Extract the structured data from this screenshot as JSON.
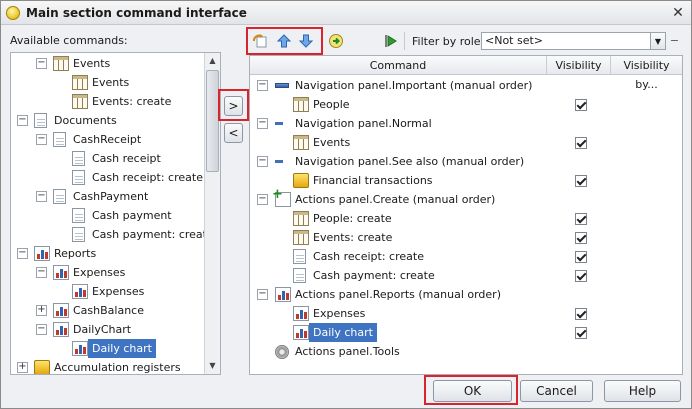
{
  "window": {
    "title": "Main section command interface",
    "close": "✕"
  },
  "left": {
    "label": "Available commands:",
    "tree": [
      {
        "level": 1,
        "toggle": "−",
        "icon": "catalog-icon",
        "label": "Events"
      },
      {
        "level": 2,
        "toggle": "",
        "icon": "catalog-icon",
        "label": "Events"
      },
      {
        "level": 2,
        "toggle": "",
        "icon": "catalog-icon",
        "label": "Events: create"
      },
      {
        "level": 0,
        "toggle": "−",
        "icon": "document-icon",
        "label": "Documents"
      },
      {
        "level": 1,
        "toggle": "−",
        "icon": "document-icon",
        "label": "CashReceipt"
      },
      {
        "level": 2,
        "toggle": "",
        "icon": "document-icon",
        "label": "Cash receipt"
      },
      {
        "level": 2,
        "toggle": "",
        "icon": "document-icon",
        "label": "Cash receipt: create"
      },
      {
        "level": 1,
        "toggle": "−",
        "icon": "document-icon",
        "label": "CashPayment"
      },
      {
        "level": 2,
        "toggle": "",
        "icon": "document-icon",
        "label": "Cash payment"
      },
      {
        "level": 2,
        "toggle": "",
        "icon": "document-icon",
        "label": "Cash payment: create"
      },
      {
        "level": 0,
        "toggle": "−",
        "icon": "report-icon",
        "label": "Reports"
      },
      {
        "level": 1,
        "toggle": "−",
        "icon": "report-icon",
        "label": "Expenses"
      },
      {
        "level": 2,
        "toggle": "",
        "icon": "report-icon",
        "label": "Expenses"
      },
      {
        "level": 1,
        "toggle": "+",
        "icon": "report-icon",
        "label": "CashBalance"
      },
      {
        "level": 1,
        "toggle": "−",
        "icon": "report-icon",
        "label": "DailyChart"
      },
      {
        "level": 2,
        "toggle": "",
        "icon": "report-icon",
        "label": "Daily chart",
        "selected": true
      },
      {
        "level": 0,
        "toggle": "+",
        "icon": "accumulation-register-icon",
        "label": "Accumulation registers"
      }
    ]
  },
  "middle": {
    "add": ">",
    "remove": "<"
  },
  "toolbar": {
    "filter_label": "Filter by roles:",
    "filter_value": "<Not set>",
    "filter_dropdown": "▼",
    "filter_clear": "−"
  },
  "right": {
    "columns": [
      "Command",
      "Visibility",
      "Visibility by..."
    ],
    "rows": [
      {
        "level": 0,
        "toggle": "−",
        "icon": "navigation-panel-icon",
        "label": "Navigation panel.Important (manual order)",
        "check": false
      },
      {
        "level": 1,
        "toggle": "",
        "icon": "catalog-icon",
        "label": "People",
        "check": true
      },
      {
        "level": 0,
        "toggle": "−",
        "icon": "navigation-small-icon",
        "label": "Navigation panel.Normal",
        "check": false
      },
      {
        "level": 1,
        "toggle": "",
        "icon": "catalog-icon",
        "label": "Events",
        "check": true
      },
      {
        "level": 0,
        "toggle": "−",
        "icon": "navigation-small-icon",
        "label": "Navigation panel.See also (manual order)",
        "check": false
      },
      {
        "level": 1,
        "toggle": "",
        "icon": "accumulation-register-icon",
        "label": "Financial transactions",
        "check": true
      },
      {
        "level": 0,
        "toggle": "−",
        "icon": "create-icon",
        "label": "Actions panel.Create (manual order)",
        "check": false
      },
      {
        "level": 1,
        "toggle": "",
        "icon": "catalog-icon",
        "label": "People: create",
        "check": true
      },
      {
        "level": 1,
        "toggle": "",
        "icon": "catalog-icon",
        "label": "Events: create",
        "check": true
      },
      {
        "level": 1,
        "toggle": "",
        "icon": "document-icon",
        "label": "Cash receipt: create",
        "check": true
      },
      {
        "level": 1,
        "toggle": "",
        "icon": "document-icon",
        "label": "Cash payment: create",
        "check": true
      },
      {
        "level": 0,
        "toggle": "−",
        "icon": "report-icon",
        "label": "Actions panel.Reports (manual order)",
        "check": false
      },
      {
        "level": 1,
        "toggle": "",
        "icon": "report-icon",
        "label": "Expenses",
        "check": true
      },
      {
        "level": 1,
        "toggle": "",
        "icon": "report-icon",
        "label": "Daily chart",
        "check": true,
        "selected": true
      },
      {
        "level": 0,
        "toggle": "",
        "icon": "gear-icon",
        "label": "Actions panel.Tools",
        "check": false
      }
    ]
  },
  "buttons": {
    "ok": "OK",
    "cancel": "Cancel",
    "help": "Help"
  },
  "colors": {
    "highlight": "#d9242b",
    "selection": "#3f74c2"
  }
}
